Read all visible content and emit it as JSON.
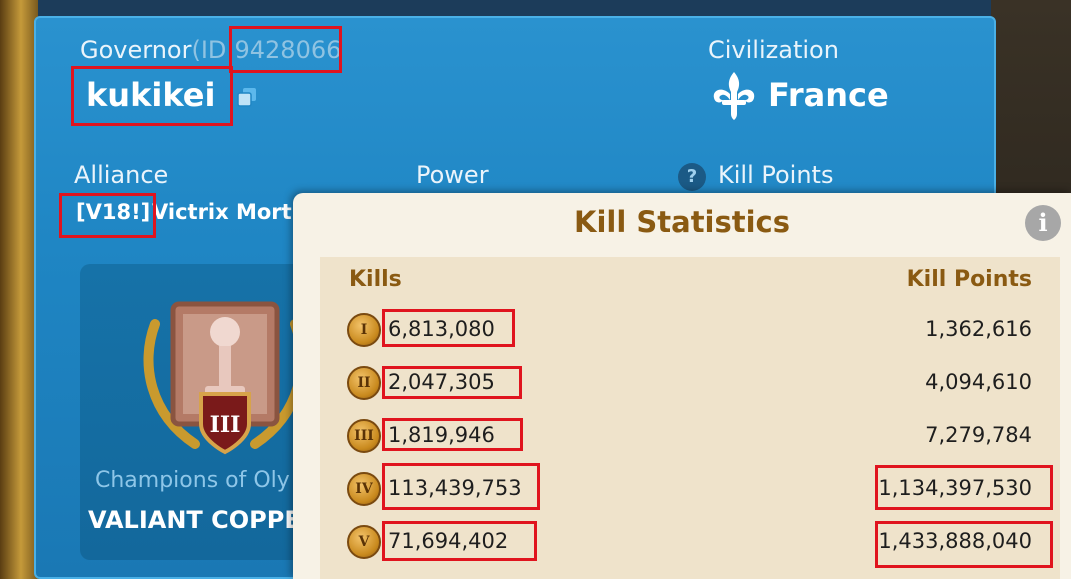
{
  "governor": {
    "label": "Governor",
    "id_prefix": "(ID:",
    "id": "9428066",
    "name": "kukikei"
  },
  "civilization": {
    "label": "Civilization",
    "name": "France"
  },
  "alliance": {
    "label": "Alliance",
    "tag": "[V18!]",
    "name": "Victrix Morti"
  },
  "power": {
    "label": "Power"
  },
  "kill_points": {
    "label": "Kill Points"
  },
  "honor": {
    "title": "Champions of Oly",
    "rank": "VALIANT COPPE",
    "tier": "III"
  },
  "kill_stats": {
    "title": "Kill Statistics",
    "col_kills": "Kills",
    "col_points": "Kill Points",
    "rows": [
      {
        "tier": "I",
        "kills": "6,813,080",
        "points": "1,362,616"
      },
      {
        "tier": "II",
        "kills": "2,047,305",
        "points": "4,094,610"
      },
      {
        "tier": "III",
        "kills": "1,819,946",
        "points": "7,279,784"
      },
      {
        "tier": "IV",
        "kills": "113,439,753",
        "points": "1,134,397,530"
      },
      {
        "tier": "V",
        "kills": "71,694,402",
        "points": "1,433,888,040"
      }
    ]
  },
  "colors": {
    "panel": "#1f86c4",
    "highlight": "#e0141e",
    "popup": "#f7f2e6",
    "title": "#8a5a12"
  }
}
